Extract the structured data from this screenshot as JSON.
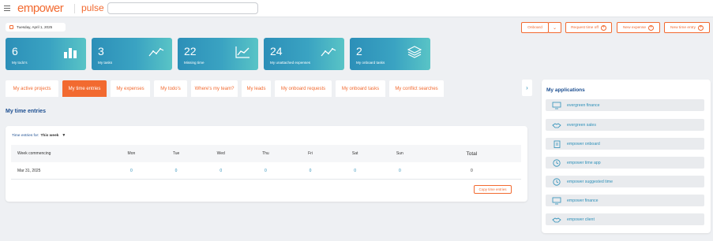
{
  "header": {
    "logo_text": "empower",
    "logo_sub": "pulse · empower",
    "app_name": "pulse",
    "search_placeholder": ""
  },
  "date_chip": "Tuesday, April 1, 2025",
  "actions": {
    "onboard": "Onboard",
    "request_time_off": "Request time off",
    "new_expense": "New expense",
    "new_time_entry": "New time entry"
  },
  "tiles": [
    {
      "value": "6",
      "label": "My todo's",
      "icon": "bar-chart-icon"
    },
    {
      "value": "3",
      "label": "My tasks",
      "icon": "trend-line-icon"
    },
    {
      "value": "22",
      "label": "Missing time",
      "icon": "line-chart-icon"
    },
    {
      "value": "24",
      "label": "My unattached expenses",
      "icon": "trend-line-icon"
    },
    {
      "value": "2",
      "label": "My onboard tasks",
      "icon": "layers-icon"
    }
  ],
  "tabs": [
    {
      "label": "My active projects",
      "active": false
    },
    {
      "label": "My time entries",
      "active": true
    },
    {
      "label": "My expenses",
      "active": false
    },
    {
      "label": "My todo's",
      "active": false
    },
    {
      "label": "Where's my team?",
      "active": false
    },
    {
      "label": "My leads",
      "active": false
    },
    {
      "label": "My onboard requests",
      "active": false
    },
    {
      "label": "My onboard tasks",
      "active": false
    },
    {
      "label": "My conflict searches",
      "active": false
    }
  ],
  "section_title": "My time entries",
  "filter": {
    "label": "Time entries for:",
    "value": "This week"
  },
  "table": {
    "headers": [
      "Week commencing",
      "Mon",
      "Tue",
      "Wed",
      "Thu",
      "Fri",
      "Sat",
      "Sun",
      "Total"
    ],
    "row": [
      "Mar 31, 2025",
      "0",
      "0",
      "0",
      "0",
      "0",
      "0",
      "0",
      "0"
    ]
  },
  "copy_button": "Copy time entries",
  "applications": {
    "title": "My applications",
    "items": [
      {
        "label": "evergreen finance",
        "icon": "monitor-icon"
      },
      {
        "label": "evergreen sales",
        "icon": "handshake-icon"
      },
      {
        "label": "empower onboard",
        "icon": "clipboard-icon"
      },
      {
        "label": "empower time app",
        "icon": "clock-icon"
      },
      {
        "label": "empower suggested time",
        "icon": "clock-icon"
      },
      {
        "label": "empower finance",
        "icon": "monitor-icon"
      },
      {
        "label": "empower client",
        "icon": "handshake-icon"
      }
    ]
  },
  "colors": {
    "accent": "#f26a30",
    "brand_blue": "#1d4f91",
    "link": "#2c8fb8"
  }
}
